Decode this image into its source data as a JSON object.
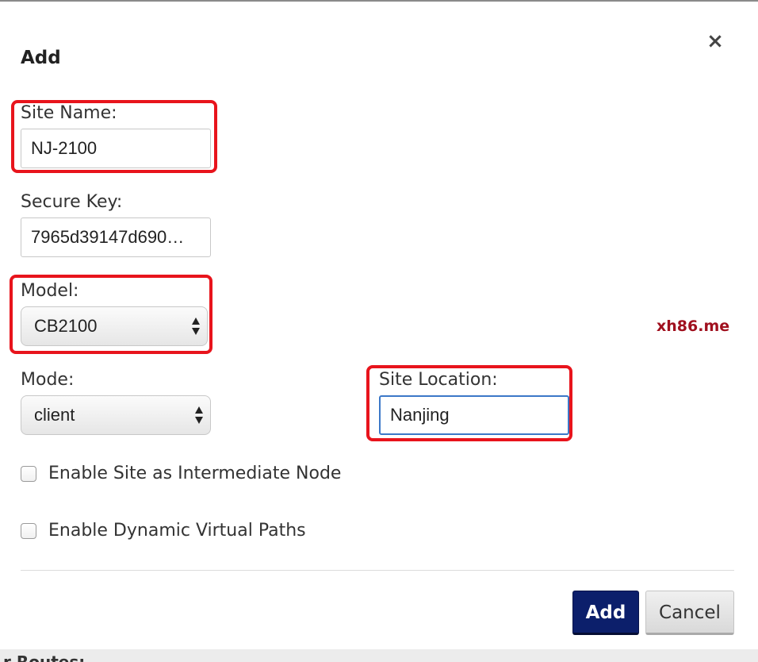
{
  "dialog": {
    "title": "Add",
    "close_symbol": "×"
  },
  "form": {
    "site_name": {
      "label": "Site Name:",
      "value": "NJ-2100"
    },
    "secure_key": {
      "label": "Secure Key:",
      "value": "7965d39147d690…"
    },
    "model": {
      "label": "Model:",
      "selected": "CB2100"
    },
    "mode": {
      "label": "Mode:",
      "selected": "client"
    },
    "site_location": {
      "label": "Site Location:",
      "value": "Nanjing"
    },
    "intermediate_node": {
      "label": "Enable Site as Intermediate Node",
      "checked": false
    },
    "dynamic_paths": {
      "label": "Enable Dynamic Virtual Paths",
      "checked": false
    }
  },
  "buttons": {
    "add_label": "Add",
    "cancel_label": "Cancel"
  },
  "watermark": "xh86.me",
  "background_text": "r Routes:",
  "colors": {
    "highlight": "#e8141c",
    "primary_button": "#0c1f6b",
    "watermark": "#a0101e",
    "focus_border": "#3c78c8"
  }
}
